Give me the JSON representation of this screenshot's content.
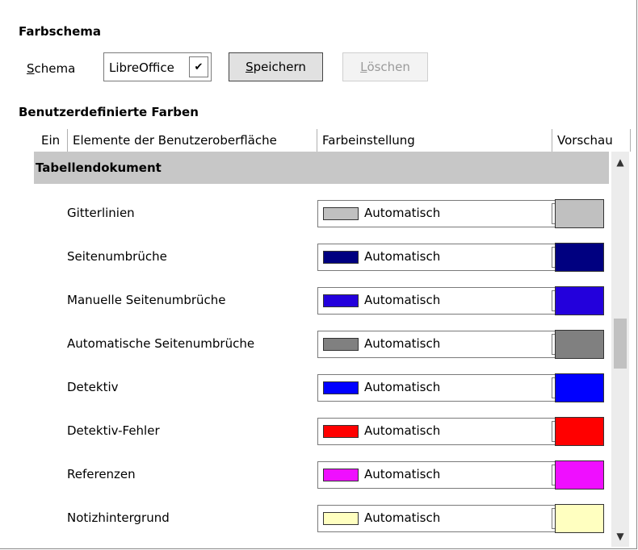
{
  "scheme": {
    "title": "Farbschema",
    "schema_label_prefix": "S",
    "schema_label_rest": "chema",
    "selected": "LibreOffice",
    "save_prefix": "S",
    "save_rest": "peichern",
    "delete_prefix": "L",
    "delete_rest": "öschen"
  },
  "custom": {
    "title": "Benutzerdefinierte Farben",
    "columns": [
      "Ein",
      "Elemente der Benutzeroberfläche",
      "Farbeinstellung",
      "Vorschau"
    ]
  },
  "group": {
    "label": "Tabellendokument"
  },
  "rows": [
    {
      "name": "Gitterlinien",
      "setting": "Automatisch",
      "color": "#c0c0c0"
    },
    {
      "name": "Seitenumbrüche",
      "setting": "Automatisch",
      "color": "#000080"
    },
    {
      "name": "Manuelle Seitenumbrüche",
      "setting": "Automatisch",
      "color": "#2300dc"
    },
    {
      "name": "Automatische Seitenumbrüche",
      "setting": "Automatisch",
      "color": "#808080"
    },
    {
      "name": "Detektiv",
      "setting": "Automatisch",
      "color": "#0000ff"
    },
    {
      "name": "Detektiv-Fehler",
      "setting": "Automatisch",
      "color": "#ff0000"
    },
    {
      "name": "Referenzen",
      "setting": "Automatisch",
      "color": "#ef0fff"
    },
    {
      "name": "Notizhintergrund",
      "setting": "Automatisch",
      "color": "#ffffc0"
    }
  ]
}
